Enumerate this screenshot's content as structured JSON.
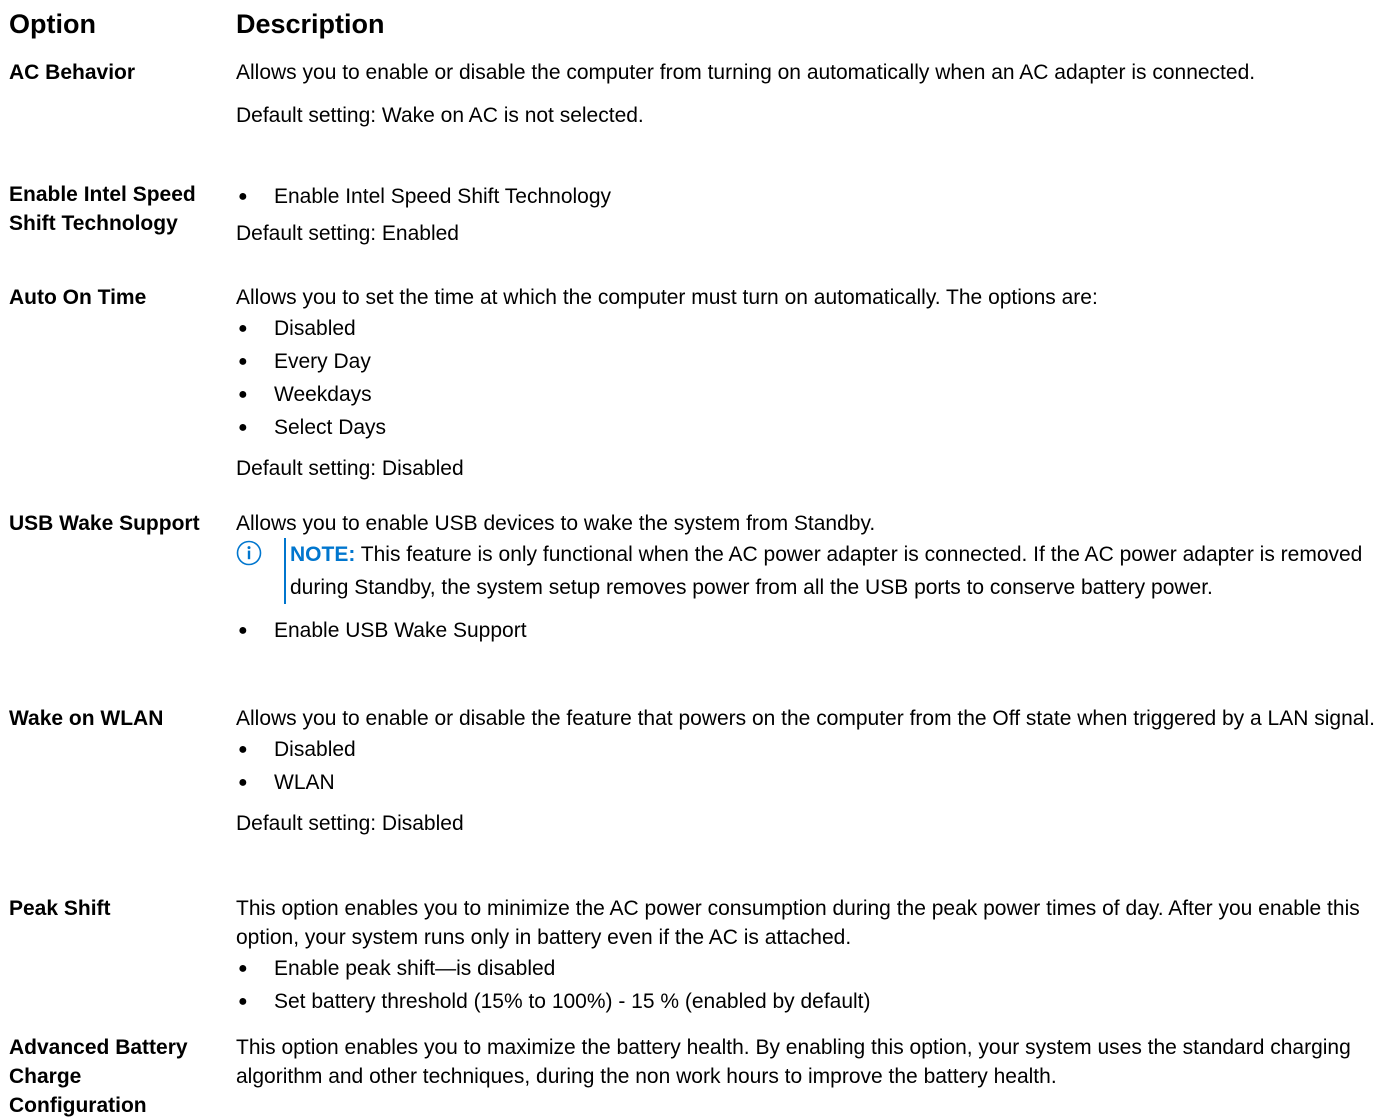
{
  "header": {
    "option": "Option",
    "description": "Description"
  },
  "rows": [
    {
      "label": "AC Behavior",
      "desc": "Allows you to enable or disable the computer from turning on automatically when an AC adapter is connected.",
      "default": "Default setting: Wake on AC is not selected."
    },
    {
      "label": "Enable Intel Speed Shift Technology",
      "bullets": [
        "Enable Intel Speed Shift Technology"
      ],
      "default": "Default setting: Enabled"
    },
    {
      "label": "Auto On Time",
      "desc": "Allows you to set the time at which the computer must turn on automatically. The options are:",
      "bullets": [
        "Disabled",
        "Every Day",
        "Weekdays",
        "Select Days"
      ],
      "default": "Default setting: Disabled"
    },
    {
      "label": "USB Wake Support",
      "desc": "Allows you to enable USB devices to wake the system from Standby.",
      "note_label": "NOTE:",
      "note_text": "This feature is only functional when the AC power adapter is connected. If the AC power adapter is removed during Standby, the system setup removes power from all the USB ports to conserve battery power.",
      "bullets": [
        "Enable USB Wake Support"
      ]
    },
    {
      "label": "Wake on WLAN",
      "desc": "Allows you to enable or disable the feature that powers on the computer from the Off state when triggered by a LAN signal.",
      "bullets": [
        "Disabled",
        "WLAN"
      ],
      "default": "Default setting: Disabled"
    },
    {
      "label": "Peak Shift",
      "desc": "This option enables you to minimize the AC power consumption during the peak power times of day. After you enable this option, your system runs only in battery even if the AC is attached.",
      "bullets": [
        "Enable peak shift—is disabled",
        "Set battery threshold (15% to 100%) - 15 % (enabled by default)"
      ]
    },
    {
      "label": "Advanced Battery Charge Configuration",
      "desc": "This option enables you to maximize the battery health. By enabling this option, your system uses the standard charging algorithm and other techniques, during the non work hours to improve the battery health."
    }
  ],
  "colors": {
    "note_accent": "#0076ce"
  },
  "icons": {
    "note": "info-icon",
    "bullet": "bullet-dot"
  }
}
